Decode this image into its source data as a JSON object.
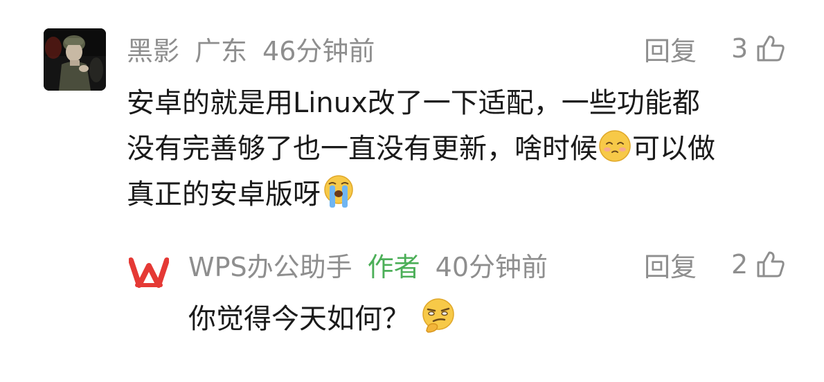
{
  "main_comment": {
    "username": "黑影",
    "location": "广东",
    "time": "46分钟前",
    "reply_label": "回复",
    "like_count": "3",
    "text_lines": [
      "安卓的就是用Linux改了一下适配，一些功能都",
      "没有完善够了也一直没有更新，啥时候",
      "可以做",
      "真正的安卓版呀"
    ],
    "emojis": [
      "pleading-face-icon",
      "loudly-crying-face-icon"
    ]
  },
  "reply": {
    "username": "WPS办公助手",
    "author_tag": "作者",
    "time": "40分钟前",
    "reply_label": "回复",
    "like_count": "2",
    "text": "你觉得今天如何？",
    "emoji": "thinking-smirk-face-icon"
  },
  "colors": {
    "meta_gray": "#8e8e8e",
    "text": "#1a1a1a",
    "author_green": "#4caf58",
    "wps_red": "#e53935",
    "background": "#ffffff"
  }
}
